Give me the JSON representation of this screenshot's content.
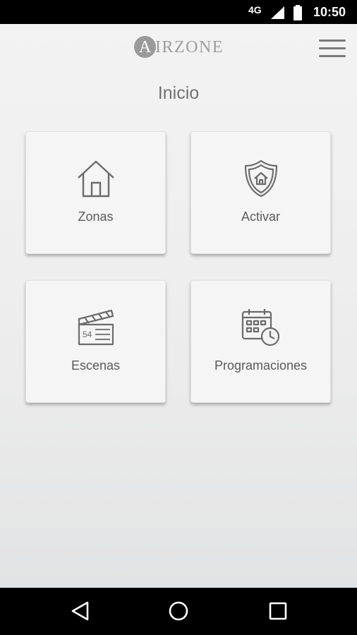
{
  "status_bar": {
    "network": "4G",
    "time": "10:50"
  },
  "header": {
    "logo_initial": "A",
    "logo_text": "IRZONE",
    "menu_icon": "hamburger-menu-icon"
  },
  "page_title": "Inicio",
  "tiles": [
    {
      "label": "Zonas",
      "icon": "house-icon"
    },
    {
      "label": "Activar",
      "icon": "shield-home-icon"
    },
    {
      "label": "Escenas",
      "icon": "clapperboard-icon"
    },
    {
      "label": "Programaciones",
      "icon": "calendar-clock-icon"
    }
  ],
  "nav_bar": {
    "back_icon": "back-triangle-icon",
    "home_icon": "home-circle-icon",
    "recents_icon": "recents-square-icon"
  },
  "colors": {
    "background": "#efefef",
    "tile": "#f5f5f5",
    "text": "#5a5a5a",
    "logo": "#9a9a9a"
  }
}
